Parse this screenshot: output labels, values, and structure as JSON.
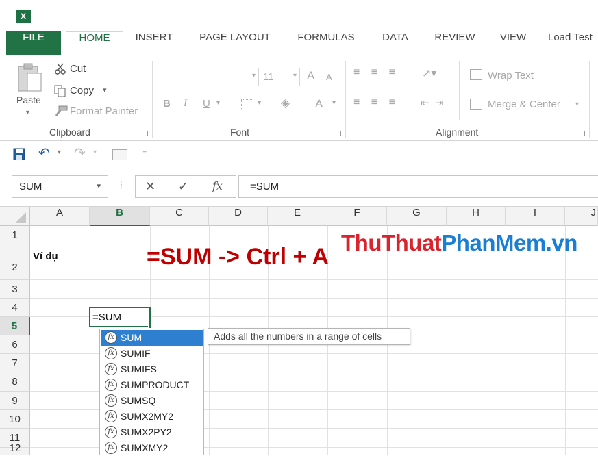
{
  "app": {
    "icon_label": "X"
  },
  "tabs": [
    "FILE",
    "HOME",
    "INSERT",
    "PAGE LAYOUT",
    "FORMULAS",
    "DATA",
    "REVIEW",
    "VIEW",
    "Load Test"
  ],
  "ribbon": {
    "clipboard": {
      "paste": "Paste",
      "cut": "Cut",
      "copy": "Copy",
      "format_painter": "Format Painter",
      "label": "Clipboard"
    },
    "font": {
      "size": "11",
      "bold": "B",
      "italic": "I",
      "underline": "U",
      "font_color": "A",
      "grow": "A",
      "shrink": "A",
      "label": "Font"
    },
    "alignment": {
      "wrap_text": "Wrap Text",
      "merge_center": "Merge & Center",
      "label": "Alignment"
    }
  },
  "formula_bar": {
    "name_box": "SUM",
    "cancel": "✕",
    "enter": "✓",
    "fx": "fx",
    "formula": "=SUM"
  },
  "columns": [
    "A",
    "B",
    "C",
    "D",
    "E",
    "F",
    "G",
    "H",
    "I",
    "J"
  ],
  "rows": [
    "1",
    "2",
    "3",
    "4",
    "5",
    "6",
    "7",
    "8",
    "9",
    "10",
    "11",
    "12"
  ],
  "cells": {
    "a2": "Ví dụ",
    "banner": "=SUM -> Ctrl + A",
    "watermark_part1": "ThuThuat",
    "watermark_part2": "PhanMem",
    "watermark_part3": ".vn",
    "b5": "=SUM"
  },
  "autocomplete": {
    "items": [
      "SUM",
      "SUMIF",
      "SUMIFS",
      "SUMPRODUCT",
      "SUMSQ",
      "SUMX2MY2",
      "SUMX2PY2",
      "SUMXMY2"
    ],
    "tooltip": "Adds all the numbers in a range of cells"
  },
  "colors": {
    "excel_green": "#217346",
    "banner_red": "#c00000",
    "watermark_red": "#d9232d",
    "watermark_blue": "#1a7fd4",
    "selection_blue": "#2f7fd1"
  }
}
